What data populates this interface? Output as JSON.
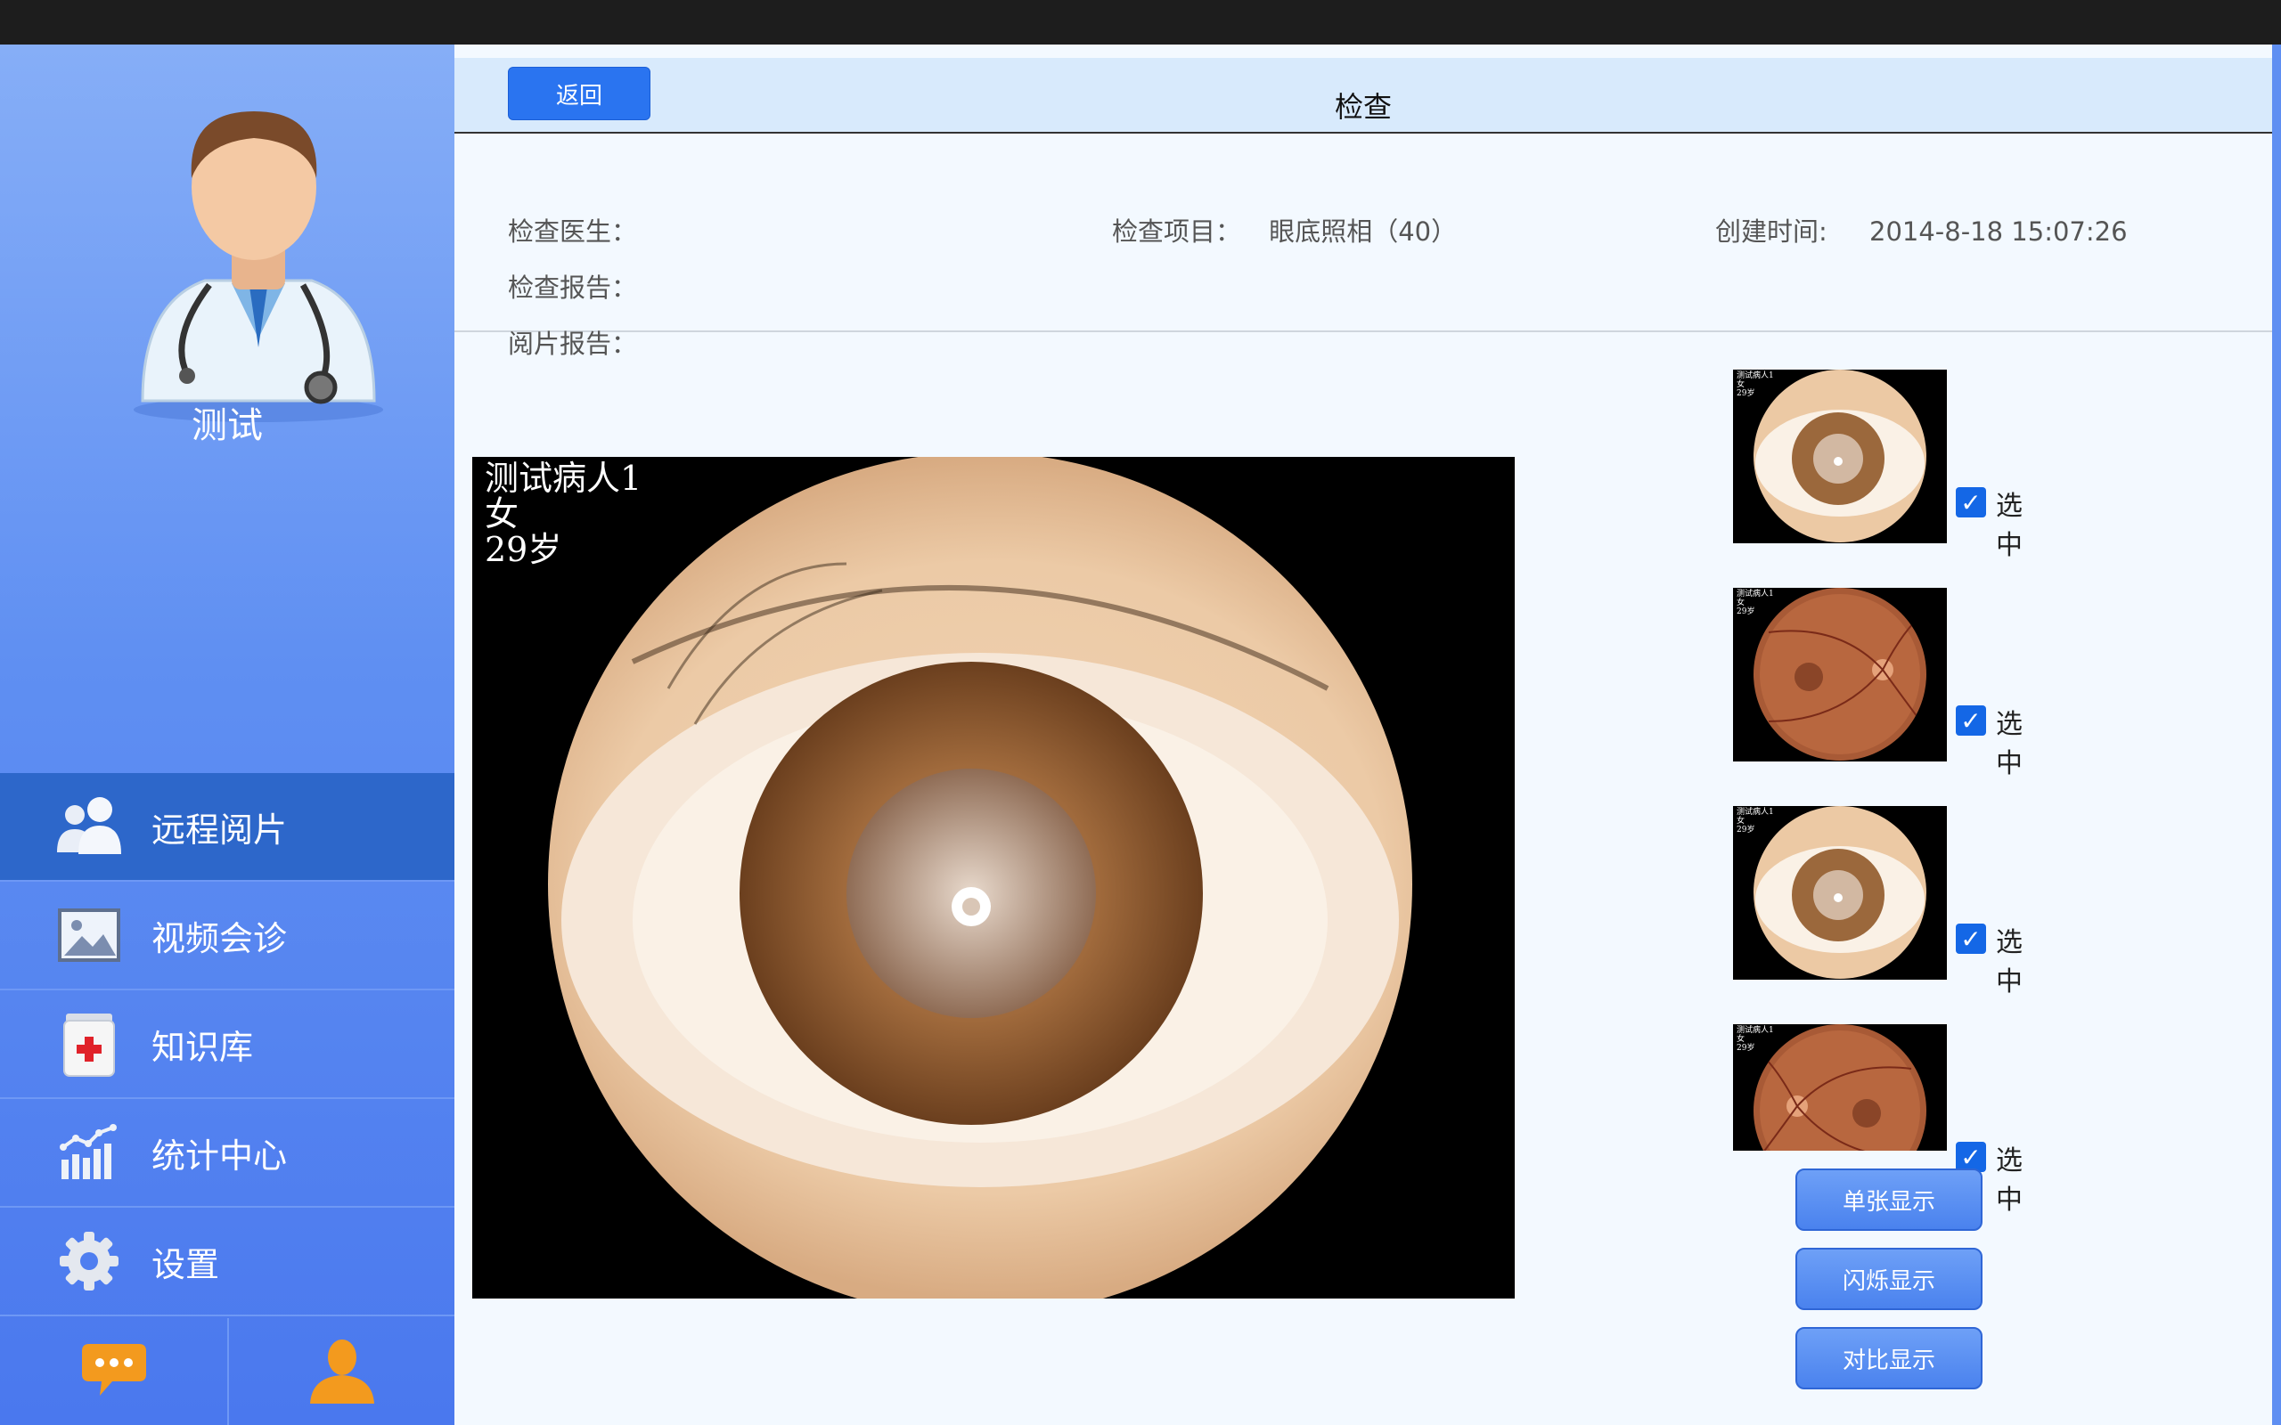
{
  "sidebar": {
    "user_name": "测试",
    "nav": [
      {
        "label": "远程阅片",
        "icon": "users-icon",
        "active": true
      },
      {
        "label": "视频会诊",
        "icon": "image-icon",
        "active": false
      },
      {
        "label": "知识库",
        "icon": "medical-kit-icon",
        "active": false
      },
      {
        "label": "统计中心",
        "icon": "chart-icon",
        "active": false
      },
      {
        "label": "设置",
        "icon": "gear-icon",
        "active": false
      }
    ],
    "bottom": [
      {
        "icon": "chat-icon"
      },
      {
        "icon": "person-icon"
      }
    ]
  },
  "header": {
    "back_label": "返回",
    "title": "检查"
  },
  "info": {
    "doctor_label": "检查医生：",
    "doctor_value": "",
    "item_label": "检查项目：",
    "item_value": "眼底照相（40）",
    "created_label": "创建时间:",
    "created_value": "2014-8-18 15:07:26",
    "report_label": "检查报告：",
    "report_value": "",
    "reading_label": "阅片报告：",
    "reading_value": ""
  },
  "main_image": {
    "line1": "测试病人1",
    "line2": "女",
    "line3": "29岁"
  },
  "thumbnails": [
    {
      "type": "anterior-eye",
      "checked": true,
      "label": "选中",
      "caption": [
        "测试病人1",
        "女",
        "29岁"
      ]
    },
    {
      "type": "fundus",
      "checked": true,
      "label": "选中",
      "caption": [
        "测试病人1",
        "女",
        "29岁"
      ]
    },
    {
      "type": "anterior-eye",
      "checked": true,
      "label": "选中",
      "caption": [
        "测试病人1",
        "女",
        "29岁"
      ]
    },
    {
      "type": "fundus",
      "checked": true,
      "label": "选中",
      "caption": [
        "测试病人1",
        "女",
        "29岁"
      ]
    }
  ],
  "actions": {
    "single": "单张显示",
    "flicker": "闪烁显示",
    "compare": "对比显示"
  },
  "colors": {
    "accent": "#2a74f0",
    "sidebar_active": "#2d67ca",
    "checkbox": "#1467e6"
  }
}
